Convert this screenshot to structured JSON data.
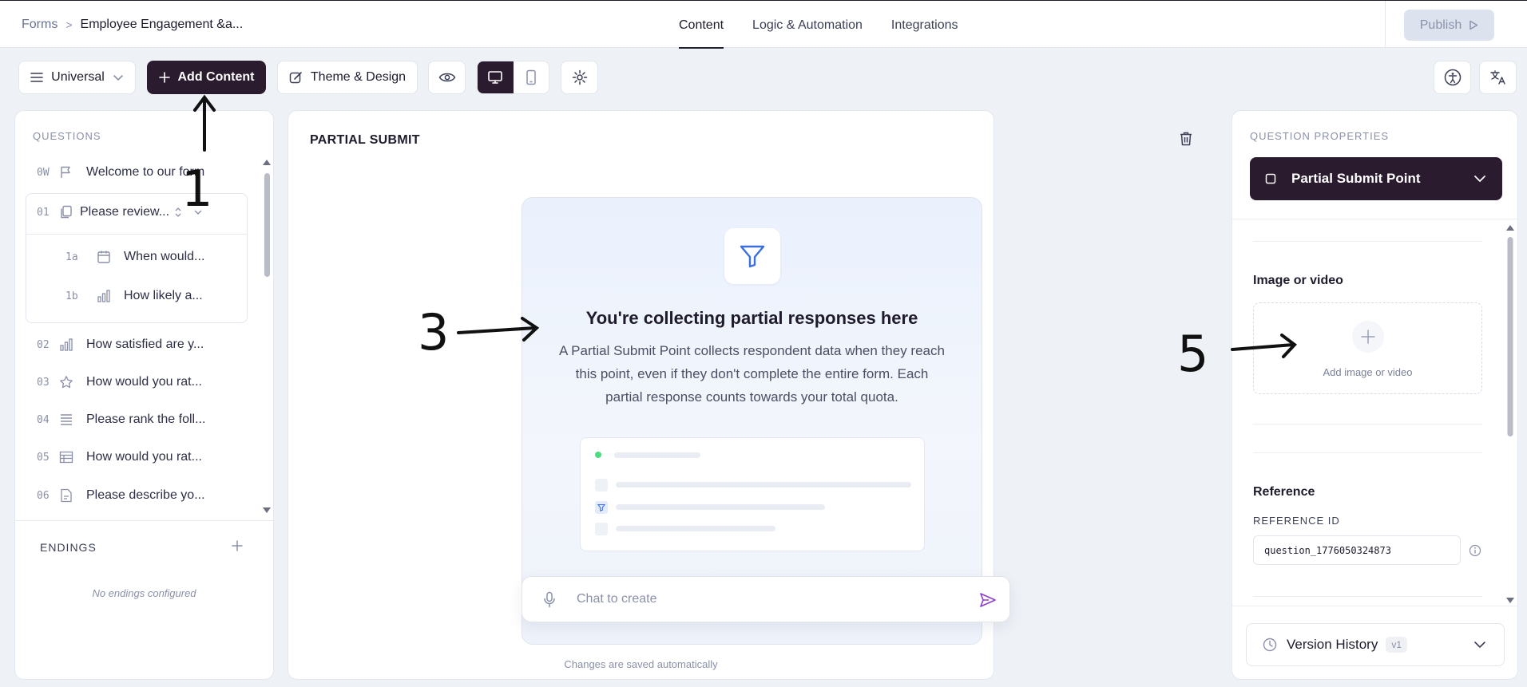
{
  "breadcrumb": {
    "root": "Forms",
    "separator": ">",
    "current": "Employee Engagement &a..."
  },
  "nav": {
    "tabs": [
      "Content",
      "Logic & Automation",
      "Integrations"
    ],
    "active": "Content"
  },
  "publish_label": "Publish",
  "toolbar": {
    "universal_label": "Universal",
    "add_content_label": "Add Content",
    "theme_label": "Theme & Design"
  },
  "questions_panel": {
    "title": "QUESTIONS",
    "items": [
      {
        "num": "0W",
        "icon": "flag-icon",
        "text": "Welcome to our form"
      },
      {
        "num": "01",
        "icon": "document-icon",
        "text": "Please review..."
      },
      {
        "num": "1a",
        "icon": "calendar-icon",
        "text": "When would..."
      },
      {
        "num": "1b",
        "icon": "bar-chart-icon",
        "text": "How likely a..."
      },
      {
        "num": "02",
        "icon": "bar-chart-icon",
        "text": "How satisfied are y..."
      },
      {
        "num": "03",
        "icon": "star-icon",
        "text": "How would you rat..."
      },
      {
        "num": "04",
        "icon": "ranking-icon",
        "text": "Please rank the foll..."
      },
      {
        "num": "05",
        "icon": "table-icon",
        "text": "How would you rat..."
      },
      {
        "num": "06",
        "icon": "file-text-icon",
        "text": "Please describe yo..."
      }
    ],
    "endings_title": "ENDINGS",
    "endings_empty": "No endings configured"
  },
  "canvas": {
    "section_title": "PARTIAL SUBMIT",
    "card_title": "You're collecting partial responses here",
    "card_desc": "A Partial Submit Point collects respondent data when they reach this point, even if they don't complete the entire form. Each partial response counts towards your total quota.",
    "chat_placeholder": "Chat to create",
    "saved_note": "Changes are saved automatically"
  },
  "properties": {
    "title": "QUESTION PROPERTIES",
    "selected_type": "Partial Submit Point",
    "media_heading": "Image or video",
    "add_media_label": "Add image or video",
    "reference_heading": "Reference",
    "reference_id_label": "REFERENCE ID",
    "reference_id_value": "question_1776050324873",
    "version_history_label": "Version History",
    "version_badge": "v1"
  },
  "annotations": [
    "1",
    "3",
    "5"
  ],
  "colors": {
    "dark": "#2a1b2e",
    "accent_purple": "#8b3fd1",
    "funnel_blue": "#3b6fe0"
  }
}
